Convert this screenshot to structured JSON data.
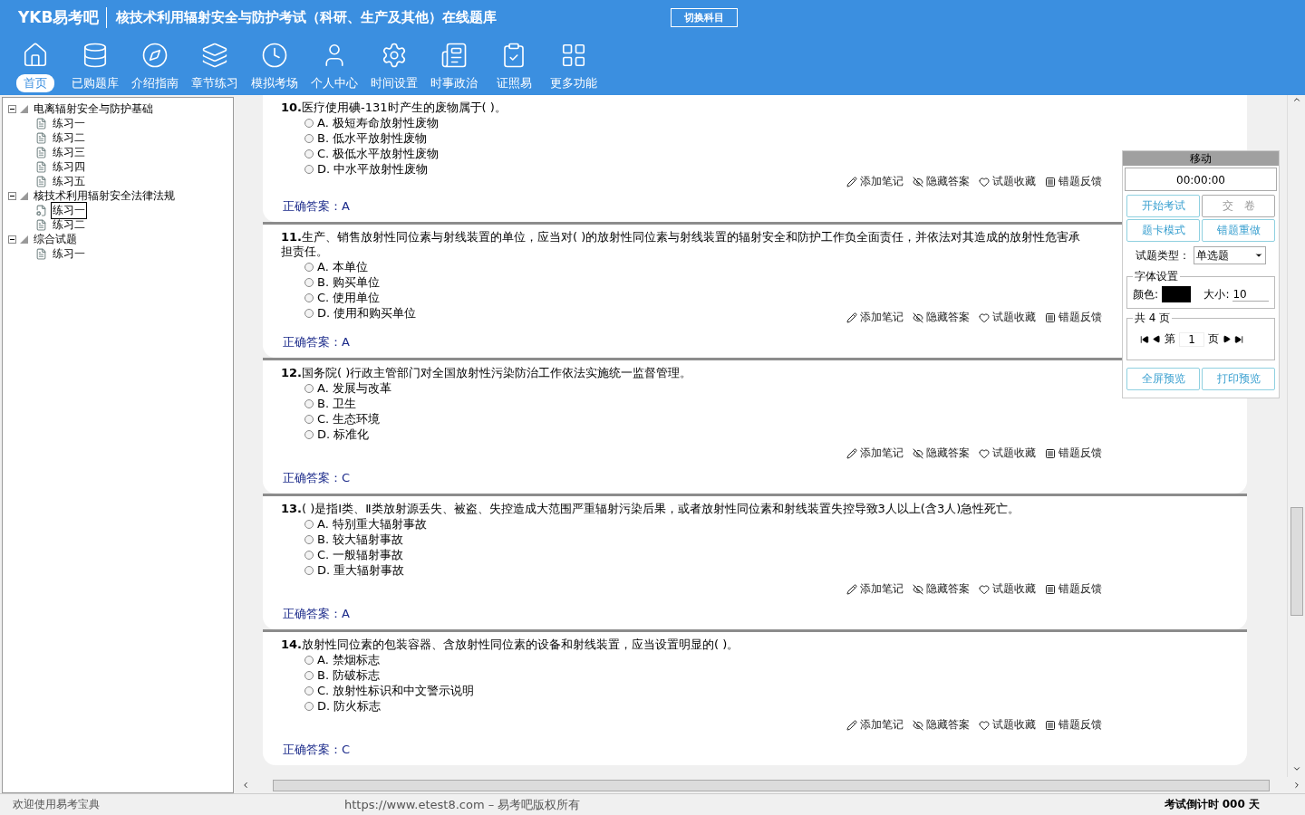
{
  "header": {
    "logo": "YKB易考吧",
    "title": "核技术利用辐射安全与防护考试（科研、生产及其他）在线题库",
    "switch_button": "切换科目"
  },
  "nav": [
    {
      "label": "首页",
      "selected": true
    },
    {
      "label": "已购题库",
      "selected": false
    },
    {
      "label": "介绍指南",
      "selected": false
    },
    {
      "label": "章节练习",
      "selected": false
    },
    {
      "label": "模拟考场",
      "selected": false
    },
    {
      "label": "个人中心",
      "selected": false
    },
    {
      "label": "时间设置",
      "selected": false
    },
    {
      "label": "时事政治",
      "selected": false
    },
    {
      "label": "证照易",
      "selected": false
    },
    {
      "label": "更多功能",
      "selected": false
    }
  ],
  "tree": [
    {
      "label": "电离辐射安全与防护基础",
      "expanded": true,
      "children": [
        {
          "label": "练习一",
          "selected": false
        },
        {
          "label": "练习二",
          "selected": false
        },
        {
          "label": "练习三",
          "selected": false
        },
        {
          "label": "练习四",
          "selected": false
        },
        {
          "label": "练习五",
          "selected": false
        }
      ]
    },
    {
      "label": "核技术利用辐射安全法律法规",
      "expanded": true,
      "children": [
        {
          "label": "练习一",
          "selected": true
        },
        {
          "label": "练习二",
          "selected": false
        }
      ]
    },
    {
      "label": "综合试题",
      "expanded": true,
      "children": [
        {
          "label": "练习一",
          "selected": false
        }
      ]
    }
  ],
  "questions": [
    {
      "number": "10.",
      "text": "医疗使用碘-131时产生的废物属于( )。",
      "options": [
        {
          "letter": "A.",
          "text": "极短寿命放射性废物",
          "selected": false
        },
        {
          "letter": "B.",
          "text": "低水平放射性废物",
          "selected": false
        },
        {
          "letter": "C.",
          "text": "极低水平放射性废物",
          "selected": false
        },
        {
          "letter": "D.",
          "text": "中水平放射性废物",
          "selected": false
        }
      ],
      "actions": [
        {
          "kind": "note",
          "label": "添加笔记"
        },
        {
          "kind": "hide",
          "label": "隐藏答案"
        },
        {
          "kind": "favorite",
          "label": "试题收藏"
        },
        {
          "kind": "report",
          "label": "错题反馈"
        }
      ],
      "answer_label": "正确答案：",
      "answer": "A"
    },
    {
      "number": "11.",
      "text": "生产、销售放射性同位素与射线装置的单位，应当对( )的放射性同位素与射线装置的辐射安全和防护工作负全面责任，并依法对其造成的放射性危害承担责任。",
      "options": [
        {
          "letter": "A.",
          "text": "本单位",
          "selected": false
        },
        {
          "letter": "B.",
          "text": "购买单位",
          "selected": false
        },
        {
          "letter": "C.",
          "text": "使用单位",
          "selected": false
        },
        {
          "letter": "D.",
          "text": "使用和购买单位",
          "selected": false
        }
      ],
      "actions": [
        {
          "kind": "note",
          "label": "添加笔记"
        },
        {
          "kind": "hide",
          "label": "隐藏答案"
        },
        {
          "kind": "favorite",
          "label": "试题收藏"
        },
        {
          "kind": "report",
          "label": "错题反馈"
        }
      ],
      "answer_label": "正确答案：",
      "answer": "A"
    },
    {
      "number": "12.",
      "text": "国务院( )行政主管部门对全国放射性污染防治工作依法实施统一监督管理。",
      "options": [
        {
          "letter": "A.",
          "text": "发展与改革",
          "selected": false
        },
        {
          "letter": "B.",
          "text": "卫生",
          "selected": false
        },
        {
          "letter": "C.",
          "text": "生态环境",
          "selected": false
        },
        {
          "letter": "D.",
          "text": "标准化",
          "selected": false
        }
      ],
      "actions": [
        {
          "kind": "note",
          "label": "添加笔记"
        },
        {
          "kind": "hide",
          "label": "隐藏答案"
        },
        {
          "kind": "favorite",
          "label": "试题收藏"
        },
        {
          "kind": "report",
          "label": "错题反馈"
        }
      ],
      "answer_label": "正确答案：",
      "answer": "C"
    },
    {
      "number": "13.",
      "text": "( )是指Ⅰ类、Ⅱ类放射源丢失、被盗、失控造成大范围严重辐射污染后果，或者放射性同位素和射线装置失控导致3人以上(含3人)急性死亡。",
      "options": [
        {
          "letter": "A.",
          "text": "特别重大辐射事故",
          "selected": false
        },
        {
          "letter": "B.",
          "text": "较大辐射事故",
          "selected": false
        },
        {
          "letter": "C.",
          "text": "一般辐射事故",
          "selected": false
        },
        {
          "letter": "D.",
          "text": "重大辐射事故",
          "selected": false
        }
      ],
      "actions": [
        {
          "kind": "note",
          "label": "添加笔记"
        },
        {
          "kind": "hide",
          "label": "隐藏答案"
        },
        {
          "kind": "favorite",
          "label": "试题收藏"
        },
        {
          "kind": "report",
          "label": "错题反馈"
        }
      ],
      "answer_label": "正确答案：",
      "answer": "A"
    },
    {
      "number": "14.",
      "text": "放射性同位素的包装容器、含放射性同位素的设备和射线装置，应当设置明显的( )。",
      "options": [
        {
          "letter": "A.",
          "text": "禁烟标志",
          "selected": false
        },
        {
          "letter": "B.",
          "text": "防破标志",
          "selected": false
        },
        {
          "letter": "C.",
          "text": "放射性标识和中文警示说明",
          "selected": false
        },
        {
          "letter": "D.",
          "text": "防火标志",
          "selected": false
        }
      ],
      "actions": [
        {
          "kind": "note",
          "label": "添加笔记"
        },
        {
          "kind": "hide",
          "label": "隐藏答案"
        },
        {
          "kind": "favorite",
          "label": "试题收藏"
        },
        {
          "kind": "report",
          "label": "错题反馈"
        }
      ],
      "answer_label": "正确答案：",
      "answer": "C"
    }
  ],
  "panel": {
    "title": "移动",
    "timer": "00:00:00",
    "buttons": [
      {
        "label": "开始考试",
        "disabled": false
      },
      {
        "label": "交　卷",
        "disabled": true
      },
      {
        "label": "题卡模式",
        "disabled": false
      },
      {
        "label": "错题重做",
        "disabled": false
      }
    ],
    "type_label": "试题类型：",
    "type_value": "单选题",
    "font_section": "字体设置",
    "color_label": "颜色:",
    "color": "#000000",
    "size_label": "大小:",
    "size_value": "10",
    "pages_title": "共 4 页",
    "page_prefix": "第",
    "page_value": "1",
    "page_suffix": "页",
    "bottom_buttons": [
      "全屏预览",
      "打印预览"
    ]
  },
  "status_bar": {
    "welcome": "欢迎使用易考宝典",
    "copyright": "https://www.etest8.com – 易考吧版权所有",
    "countdown": "考试倒计时 000 天"
  }
}
